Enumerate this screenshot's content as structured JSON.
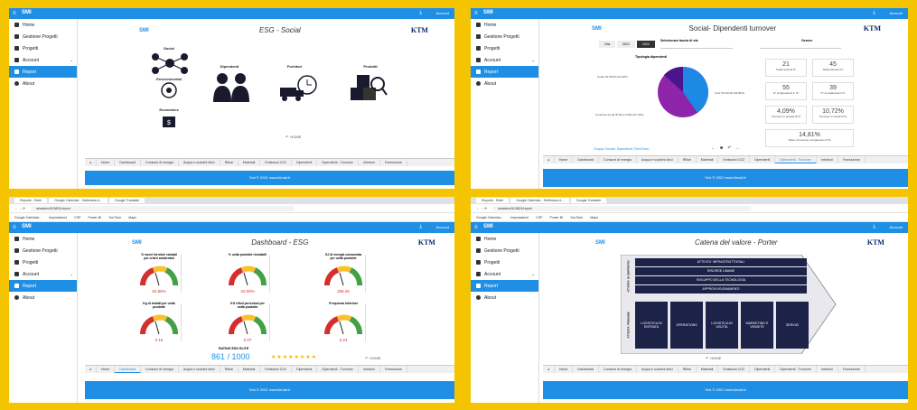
{
  "sidebar": {
    "items": [
      {
        "label": "Home",
        "icon": "grid-icon"
      },
      {
        "label": "Gestione Progetti",
        "icon": "gear-icon"
      },
      {
        "label": "Progetti",
        "icon": "file-icon"
      },
      {
        "label": "Account",
        "icon": "globe-icon"
      },
      {
        "label": "Report",
        "icon": "file-icon"
      },
      {
        "label": "About",
        "icon": "circle-icon"
      }
    ],
    "active": "Report"
  },
  "topbar": {
    "logo": "SMI",
    "account": "Account"
  },
  "browser": {
    "tab1": "Reporte - Ester",
    "tab2": "Google Calendar - Settimana d...",
    "tab3": "Google Translate",
    "url": "sesslene18.5601/report",
    "bookmarks": [
      "Google Calendar...",
      "Impostazioni",
      "CSP",
      "Power BI",
      "YouTube",
      "Maps"
    ]
  },
  "tabs": [
    "Home",
    "Dashboard",
    "Consumi di energia",
    "Acqua e scarichi idrici",
    "Rifiuti",
    "Materiali",
    "Emissioni CO2",
    "Dipendenti",
    "Dipendenti - Turnover",
    "Infortuni",
    "Formazione",
    "Ricerca e s..."
  ],
  "footer": "Smi © 2021 www.kimati.it",
  "p1": {
    "title": "ESG - Social",
    "ktm": "KTM",
    "sm": "SMI",
    "cats": [
      "Social",
      "Environmental",
      "Economics"
    ],
    "cards": [
      "Dipendenti",
      "Fornitori",
      "Prodotti"
    ],
    "home": "HOME"
  },
  "p2": {
    "title": "Social- Dipendenti turnover",
    "ktm": "KTM",
    "filter_label": "Selezionare fascia di età",
    "genere": "Genere",
    "btns": [
      "Ora",
      "2021",
      "2022"
    ],
    "chart_title": "Tipologia dipendenti",
    "legend": [
      "Under 30 60.00 (12.29%)",
      "Over 50 (20.00 (42.86%)",
      "Compresi tra gli 30 50 (1.0100 (37.70%)"
    ],
    "kpis": [
      "21",
      "45",
      "55",
      "39",
      "4,09%",
      "10,72%",
      "14,81%"
    ],
    "kpi_sub": [
      "Totale assunti N°",
      "Totale dimessi N°",
      "N° di dipendenti in N°",
      "N° di colaboratori N°",
      "Turnover in entrata N°%",
      "Turnover in uscita N°%",
      "Tasso di turnover complessivo N°%"
    ],
    "source": "Gruppo Sociali- Dipendenti (TurnOver)"
  },
  "p3": {
    "title": "Dashboard - ESG",
    "ktm": "KTM",
    "gauges": [
      {
        "t": "% nuovi fornitori valutati per criteri ambientali",
        "v": "54.85%"
      },
      {
        "t": "% unità prodotte riciclabili",
        "v": "32.00%"
      },
      {
        "t": "GJ di energia consumata per unità prodotte",
        "v": "256.26"
      },
      {
        "t": "Kg di imballi per unità prodotte",
        "v": "0.16"
      },
      {
        "t": "KG rifiuti pericolosi per unità prodotte",
        "v": "0.07"
      },
      {
        "t": "Frequenza Infortuni",
        "v": "2.24"
      }
    ],
    "rating_title": "RATING ESG ELITE",
    "rating": "861 / 1000",
    "home": "HOME"
  },
  "p4": {
    "title": "Catena del valore - Porter",
    "ktm": "KTM",
    "support": [
      "ATTIVITA' INFRASTRUTTURALI",
      "RISORSE UMANE",
      "SVILUPPO DELLA TECNOLOGIA",
      "APPROVVIGIONAMENTI"
    ],
    "primary": [
      "LOGISTICA IN ENTRATA",
      "OPERATIONS",
      "LOGISTICA IN USCITA",
      "MARKETING E VENDITE",
      "SERVIZI"
    ],
    "support_lbl": "ATTIVITA' DI SUPPORTO",
    "primary_lbl": "ATTIVITA' PRIMARIE",
    "home": "HOME"
  }
}
